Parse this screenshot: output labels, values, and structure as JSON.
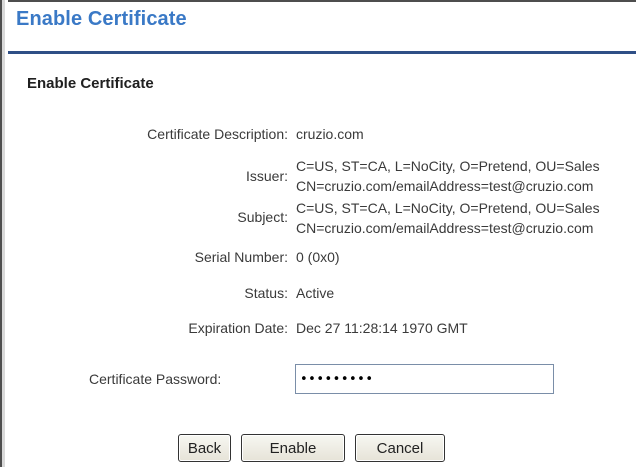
{
  "window": {
    "title": "Enable Certificate"
  },
  "section": {
    "title": "Enable Certificate"
  },
  "certificate": {
    "description_label": "Certificate Description:",
    "description_value": "cruzio.com",
    "issuer_label": "Issuer:",
    "issuer_line1": "C=US, ST=CA, L=NoCity, O=Pretend, OU=Sales",
    "issuer_line2": "CN=cruzio.com/emailAddress=test@cruzio.com",
    "subject_label": "Subject:",
    "subject_line1": "C=US, ST=CA, L=NoCity, O=Pretend, OU=Sales",
    "subject_line2": "CN=cruzio.com/emailAddress=test@cruzio.com",
    "serial_label": "Serial Number:",
    "serial_value": "0 (0x0)",
    "status_label": "Status:",
    "status_value": "Active",
    "expiration_label": "Expiration Date:",
    "expiration_value": "Dec 27 11:28:14 1970 GMT"
  },
  "password": {
    "label": "Certificate Password:",
    "value": "•••••••••"
  },
  "buttons": {
    "back": "Back",
    "enable": "Enable",
    "cancel": "Cancel"
  },
  "colors": {
    "title_blue": "#3a79c6",
    "rule_navy": "#2f4f86"
  }
}
